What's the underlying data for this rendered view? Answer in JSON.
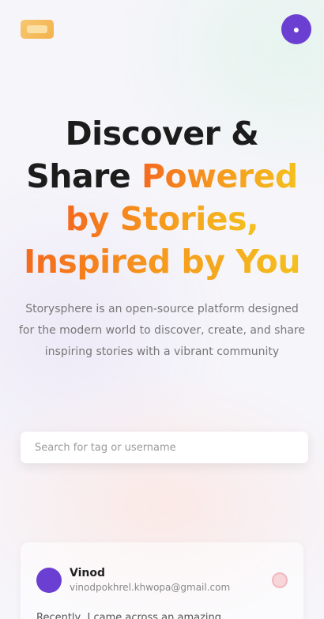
{
  "nav": {
    "logo_icon": "app-logo-icon",
    "profile_icon": "profile-avatar-icon",
    "accent_color": "#6b3fd1",
    "logo_color": "#f3b24a"
  },
  "hero": {
    "line1_dark": "Discover &",
    "line2_dark": "Share ",
    "line2_accent": "Powered",
    "line3_accent": "by Stories,",
    "line4_accent": "Inspired by You",
    "accent_gradient": [
      "#f46a1e",
      "#f4c01e"
    ]
  },
  "description": "Storysphere is an open-source platform designed for the modern world to discover, create, and share inspiring stories with a vibrant community",
  "search": {
    "placeholder": "Search for tag or username"
  },
  "card": {
    "name": "Vinod",
    "email": "vinodpokhrel.khwopa@gmail.com",
    "body": "Recently, I came across an amazing...",
    "copy_icon": "copy-icon"
  }
}
